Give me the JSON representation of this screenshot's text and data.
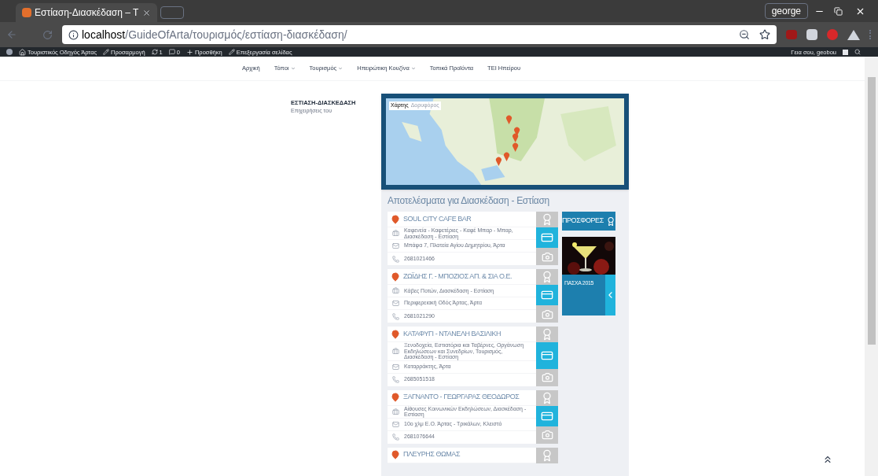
{
  "browser": {
    "tab_title": "Εστίαση-Διασκέδαση – Τ",
    "url_host": "localhost",
    "url_path": "/GuideOfArta/τουρισμός/εστίαση-διασκέδαση/",
    "profile": "george"
  },
  "admin_bar": {
    "items": [
      {
        "kind": "site",
        "label": "Τουριστικός Οδηγός Άρτας"
      },
      {
        "kind": "edit",
        "label": "Προσαρμογή"
      },
      {
        "kind": "updates",
        "label": "1"
      },
      {
        "kind": "comments",
        "label": "0"
      },
      {
        "kind": "add",
        "label": "Προσθήκη"
      },
      {
        "kind": "edit",
        "label": "Επεξεργασία σελίδας"
      }
    ],
    "greeting": "Γεια σου, geobou"
  },
  "nav": [
    {
      "label": "Αρχική",
      "dropdown": false
    },
    {
      "label": "Τόποι",
      "dropdown": true
    },
    {
      "label": "Τουρισμός",
      "dropdown": true
    },
    {
      "label": "Ηπειρώτικη Κουζίνα",
      "dropdown": true
    },
    {
      "label": "Τοπικά Προϊόντα",
      "dropdown": false
    },
    {
      "label": "ΤΕΙ Ηπείρου",
      "dropdown": false
    }
  ],
  "sidebar": {
    "title": "ΕΣΤΙΑΣΗ-ΔΙΑΣΚΕΔΑΣΗ",
    "subtitle": "Επιχειρήσεις του"
  },
  "map": {
    "types": [
      {
        "label": "Χάρτης",
        "selected": true
      },
      {
        "label": "Δορυφόρος",
        "selected": false
      }
    ]
  },
  "results": {
    "title": "Αποτελέσματα για Διασκέδαση - Εστίαση",
    "listings": [
      {
        "name": "SOUL CITY CAFE BAR",
        "category": "Καφενεία - Καφετέριες - Καφέ Μπαρ - Μπαρ, Διασκέδαση - Εστίαση",
        "address": "Μπάφα 7, Πλατεία Αγίου Δημητρίου, Άρτα",
        "phone": "2681021466"
      },
      {
        "name": "ΖΩΪΔΗΣ Γ. - ΜΠΟΖΙΟΣ ΑΠ. & ΣΙΑ Ο.Ε.",
        "category": "Κάβες Ποτών, Διασκέδαση - Εστίαση",
        "address": "Περιφερειακή Οδός Άρτας, Άρτα",
        "phone": "2681021290"
      },
      {
        "name": "ΚΑΤΑΦΥΓΙ - ΝΤΑΝΕΛΗ ΒΑΣΙΛΙΚΗ",
        "category": "Ξενοδοχεία, Εστιατόρια και Ταβέρνες, Οργάνωση Εκδηλώσεων και Συνεδρίων, Τουρισμός, Διασκέδαση - Εστίαση",
        "address": "Καταρράκτης, Άρτα",
        "phone": "2685051518"
      },
      {
        "name": "ΞΑΓΝΑΝΤΟ - ΓΕΩΡΓΑΡΑΣ ΘΕΟΔΩΡΟΣ",
        "category": "Αίθουσες Κοινωνικών Εκδηλώσεων, Διασκέδαση - Εστίαση",
        "address": "10ο χλμ Ε.Ο. Άρτας - Τρικάλων, Κλειστό",
        "phone": "2681076644"
      },
      {
        "name": "ΠΛΕΥΡΗΣ ΘΩΜΑΣ"
      }
    ]
  },
  "offers": {
    "title": "ΠΡΟΣΦΟΡΕΣ",
    "items": [
      {
        "kind": "picture",
        "caption": "ΠΑΣΧΑ 2015"
      }
    ]
  }
}
